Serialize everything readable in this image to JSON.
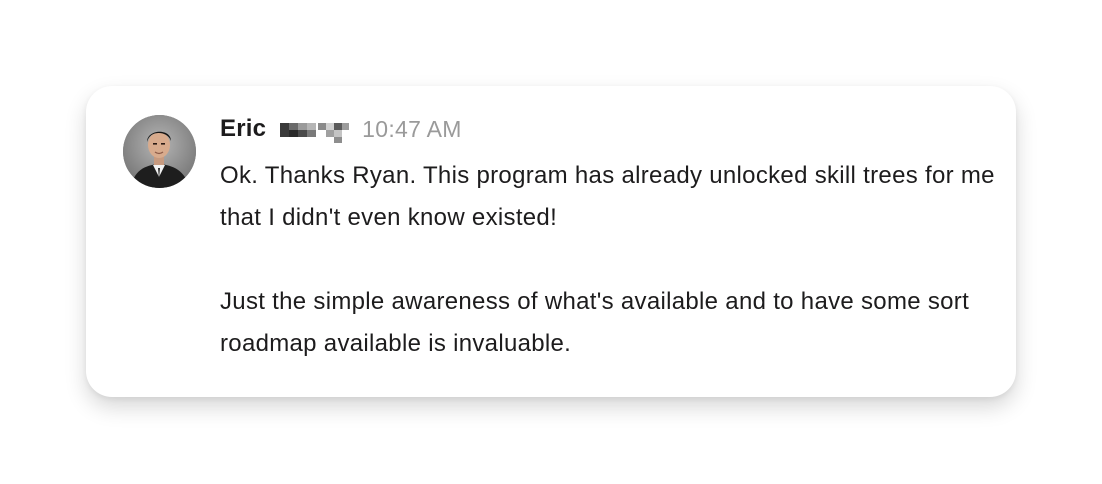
{
  "message": {
    "sender_name": "Eric",
    "timestamp": "10:47 AM",
    "paragraphs": [
      "Ok. Thanks Ryan. This program has already unlocked skill trees for me that I didn't even know existed!",
      "Just the simple awareness of what's available and to have some sort roadmap available is invaluable."
    ]
  },
  "icons": {
    "avatar": "user-photo",
    "redacted": "pixelated-surname"
  },
  "colors": {
    "text": "#1d1c1d",
    "timestamp": "#9a9a9a",
    "card_background": "#ffffff"
  }
}
